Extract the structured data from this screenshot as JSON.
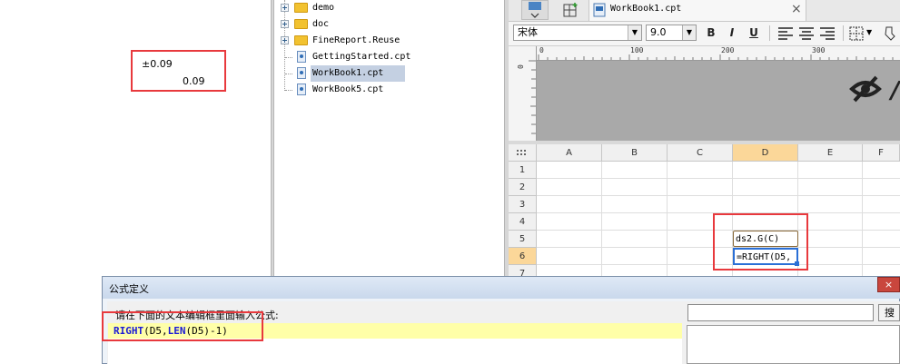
{
  "left_panel": {
    "value_with_prefix": "±0.09",
    "value_plain": "0.09"
  },
  "file_tree": {
    "items": [
      {
        "label": "demo",
        "type": "folder"
      },
      {
        "label": "doc",
        "type": "folder"
      },
      {
        "label": "FineReport.Reuse",
        "type": "folder"
      },
      {
        "label": "GettingStarted.cpt",
        "type": "file"
      },
      {
        "label": "WorkBook1.cpt",
        "type": "file",
        "selected": true
      },
      {
        "label": "WorkBook5.cpt",
        "type": "file"
      }
    ]
  },
  "designer": {
    "tab_label": "WorkBook1.cpt",
    "close_glyph": "×",
    "font_name": "宋体",
    "font_size": "9.0",
    "bold": "B",
    "italic": "I",
    "underline": "U",
    "ruler_marks": [
      "0",
      "100",
      "200",
      "300"
    ],
    "ruler_left_mark": "0",
    "columns": [
      "A",
      "B",
      "C",
      "D",
      "E",
      "F"
    ],
    "rows": [
      "1",
      "2",
      "3",
      "4",
      "5",
      "6",
      "7"
    ],
    "active_column": "D",
    "active_row": "6",
    "cells": {
      "D5": "ds2.G(C)",
      "D6": "=RIGHT(D5,"
    }
  },
  "formula_dialog": {
    "title": "公式定义",
    "instruction": "请在下面的文本编辑框里面输入公式:",
    "formula_tokens": [
      {
        "text": "RIGHT",
        "kind": "function"
      },
      {
        "text": "(D5,",
        "kind": "plain"
      },
      {
        "text": "LEN",
        "kind": "function"
      },
      {
        "text": "(D5)-1)",
        "kind": "plain"
      }
    ],
    "search_button_label": "搜",
    "close_glyph": "×"
  },
  "colors": {
    "highlight_red": "#e8393d",
    "active_header": "#fbd799",
    "formula_bg": "#ffffa8",
    "keyword_blue": "#1a1ad6"
  }
}
